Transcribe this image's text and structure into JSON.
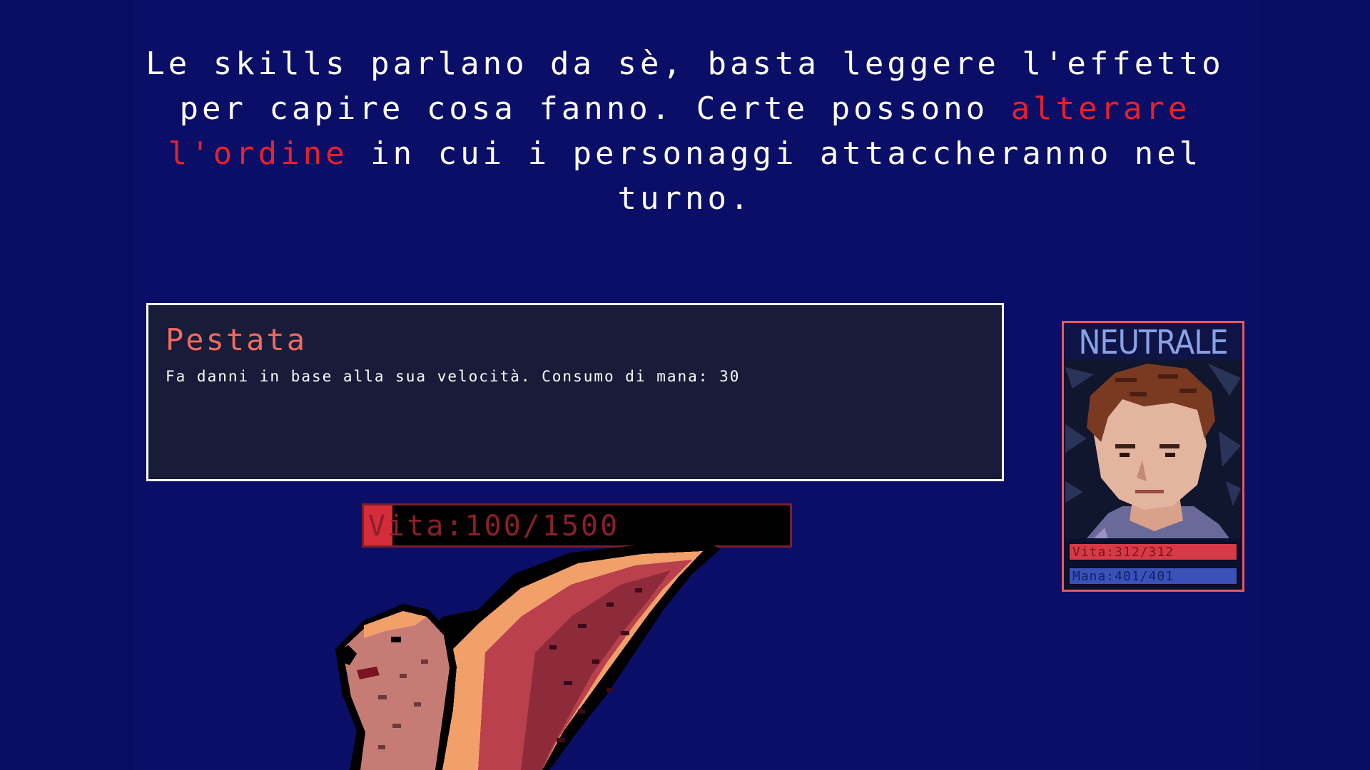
{
  "narration": {
    "part1": "Le skills parlano da sè, basta leggere l'effetto per capire cosa fanno. Certe possono ",
    "highlight": "alterare l'ordine",
    "part2": " in cui i personaggi attaccheranno nel turno."
  },
  "skill": {
    "name": "Pestata",
    "description": "Fa danni in base alla sua velocità. Consumo di mana: 30"
  },
  "enemy": {
    "hp_label": "Vita:100/1500",
    "hp_current": 100,
    "hp_max": 1500
  },
  "character": {
    "state": "NEUTRALE",
    "hp_label": "Vita:312/312",
    "hp_current": 312,
    "hp_max": 312,
    "mana_label": "Mana:401/401",
    "mana_current": 401,
    "mana_max": 401
  },
  "colors": {
    "background": "#0a0e66",
    "highlight_text": "#e8202a",
    "skill_name": "#f06a5f",
    "hp_fill": "#d42c3a",
    "mana_fill": "#3a52b8",
    "state_text": "#8aa2e6"
  },
  "icons": {
    "portrait": "character-portrait",
    "enemy": "griffin-creature"
  }
}
